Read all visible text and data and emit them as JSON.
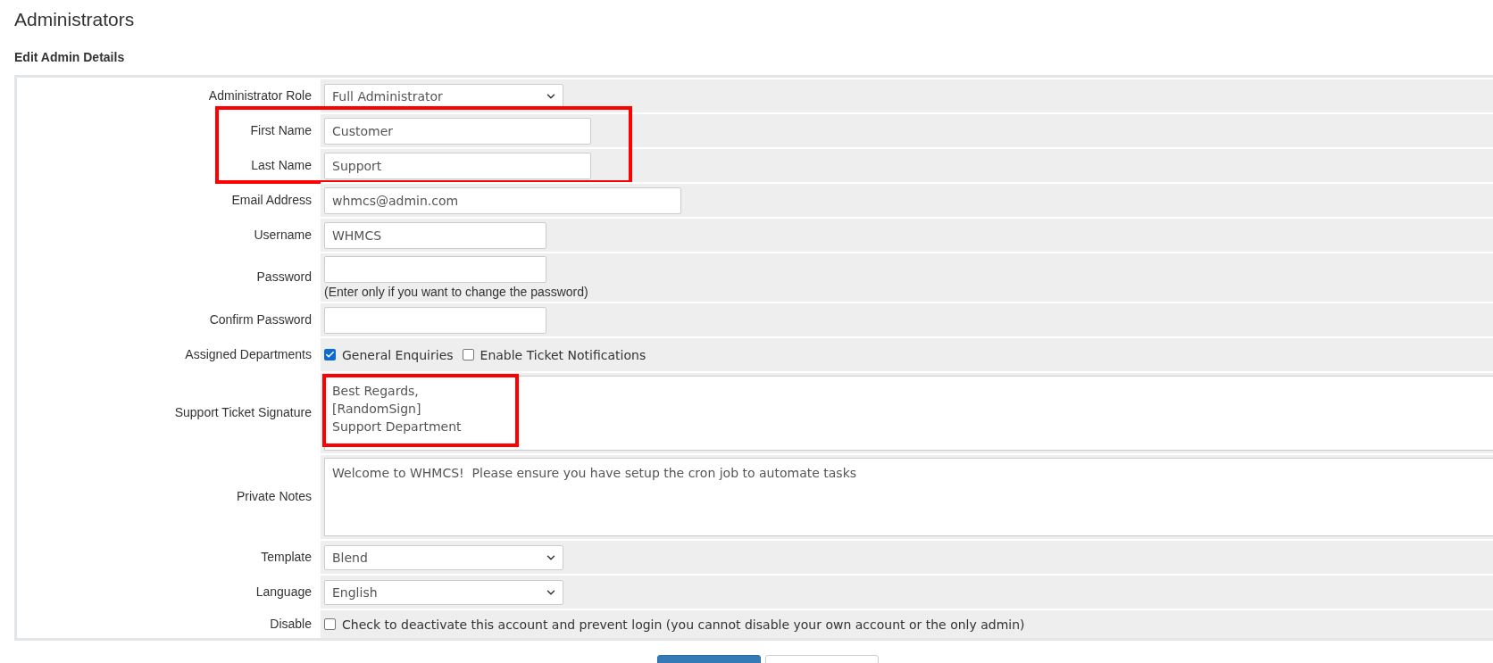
{
  "page": {
    "title": "Administrators"
  },
  "section": {
    "title": "Edit Admin Details"
  },
  "fields": [
    {
      "kind": "select",
      "label": "Administrator Role",
      "value": "Full Administrator",
      "highlighted": false
    },
    {
      "kind": "text",
      "label": "First Name",
      "value": "Customer",
      "highlighted": true
    },
    {
      "kind": "text",
      "label": "Last Name",
      "value": "Support",
      "highlighted": true
    },
    {
      "kind": "text",
      "label": "Email Address",
      "value": "whmcs@admin.com",
      "highlighted": false
    },
    {
      "kind": "text",
      "label": "Username",
      "value": "WHMCS",
      "highlighted": false
    },
    {
      "kind": "password",
      "label": "Password",
      "hint": "(Enter only if you want to change the password)",
      "highlighted": false
    },
    {
      "kind": "password",
      "label": "Confirm Password",
      "highlighted": false
    },
    {
      "kind": "checkboxes",
      "label": "Assigned Departments",
      "options": [
        {
          "label": "General Enquiries",
          "checked": true
        },
        {
          "label": "Enable Ticket Notifications",
          "checked": false
        }
      ],
      "highlighted": false
    },
    {
      "kind": "textarea",
      "label": "Support Ticket Signature",
      "value": "Best Regards,\n[RandomSign]\nSupport Department",
      "highlighted": true
    },
    {
      "kind": "textarea",
      "label": "Private Notes",
      "value": "Welcome to WHMCS!  Please ensure you have setup the cron job to automate tasks",
      "highlighted": false
    },
    {
      "kind": "select",
      "label": "Template",
      "value": "Blend",
      "highlighted": false
    },
    {
      "kind": "select",
      "label": "Language",
      "value": "English",
      "highlighted": false
    },
    {
      "kind": "checkboxes",
      "label": "Disable",
      "options": [
        {
          "label": "Check to deactivate this account and prevent login (you cannot disable your own account or the only admin)",
          "checked": false
        }
      ],
      "highlighted": false
    }
  ],
  "buttons": [
    {
      "kind": "primary"
    },
    {
      "kind": "secondary"
    }
  ]
}
